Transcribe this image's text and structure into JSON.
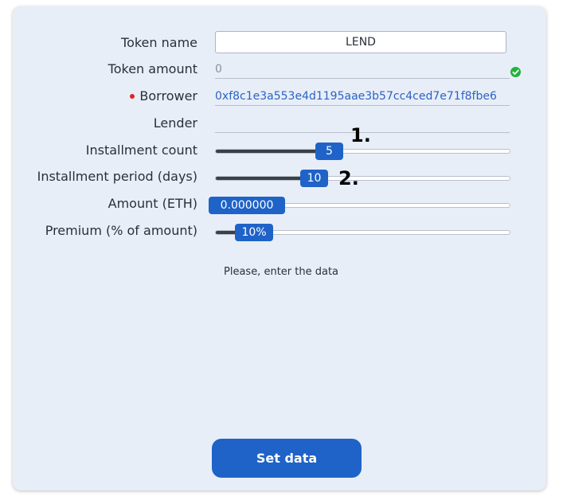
{
  "form": {
    "token_name": {
      "label": "Token name",
      "value": "LEND"
    },
    "token_amount": {
      "label": "Token amount",
      "placeholder": "0",
      "status_icon": "check-circle-icon"
    },
    "borrower": {
      "label": "Borrower",
      "value": "0xf8c1e3a553e4d1195aae3b57cc4ced7e71f8fbe6",
      "required": true
    },
    "lender": {
      "label": "Lender",
      "value": ""
    },
    "installment_count": {
      "label": "Installment count",
      "value": "5",
      "fraction": 0.38
    },
    "installment_period": {
      "label": "Installment period (days)",
      "value": "10",
      "fraction": 0.33
    },
    "amount_eth": {
      "label": "Amount (ETH)",
      "value": "0.000000",
      "fraction": 0.0
    },
    "premium": {
      "label": "Premium (% of amount)",
      "value": "10%",
      "fraction": 0.1
    }
  },
  "annotations": {
    "first": "1.",
    "second": "2."
  },
  "status_text": "Please, enter the data",
  "set_button_label": "Set data",
  "colors": {
    "accent": "#1f63c8",
    "card_bg": "#e8eef8",
    "ok": "#22b33a",
    "required": "#e02424"
  }
}
